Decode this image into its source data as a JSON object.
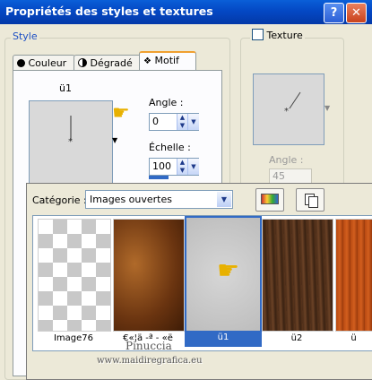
{
  "window": {
    "title": "Propriétés des styles et textures"
  },
  "style_group": {
    "legend": "Style",
    "tabs": [
      {
        "label": "Couleur",
        "icon": "circle-filled-icon"
      },
      {
        "label": "Dégradé",
        "icon": "half-circle-icon"
      },
      {
        "label": "Motif",
        "icon": "pattern-icon",
        "active": true
      }
    ],
    "pattern_name": "ü1",
    "angle_label": "Angle :",
    "angle_value": "0",
    "scale_label": "Échelle :",
    "scale_value": "100"
  },
  "texture_group": {
    "label": "Texture",
    "checked": false,
    "angle_label": "Angle :",
    "angle_value": "45"
  },
  "pattern_picker": {
    "category_label": "Catégorie :",
    "category_value": "Images ouvertes",
    "thumbnails": [
      {
        "label": "Image76"
      },
      {
        "label": "€«¦ä -ª - «ë"
      },
      {
        "label": "ü1",
        "selected": true
      },
      {
        "label": "ü2"
      },
      {
        "label": "ü"
      }
    ]
  },
  "watermark": {
    "line1": "Pinuccia",
    "line2": "www.maidiregrafica.eu"
  },
  "colors": {
    "accent": "#316ac5",
    "titlebar": "#0448c4",
    "legend": "#1c4fc4"
  }
}
